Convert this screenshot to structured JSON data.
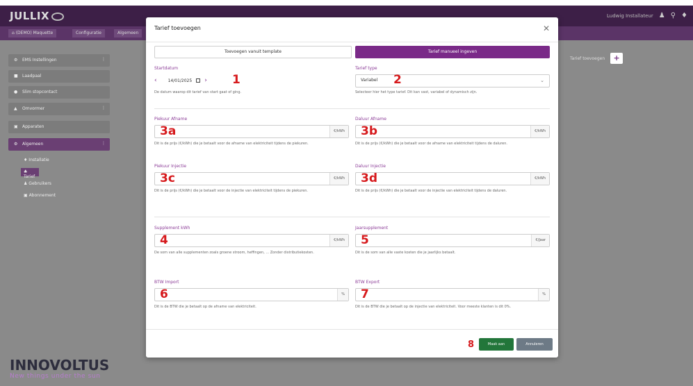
{
  "app": {
    "logo_text": "JULLIX"
  },
  "header": {
    "user_label": "Ludwig Installateur"
  },
  "breadcrumb": [
    {
      "label": "(DEMO) Maquette"
    },
    {
      "label": "Configuratie"
    },
    {
      "label": "Algemeen"
    }
  ],
  "sidebar": {
    "items": [
      {
        "icon": "gear-icon",
        "label": "EMS Instellingen",
        "has_menu": true
      },
      {
        "icon": "plug-icon",
        "label": "Laadpaal",
        "has_menu": false
      },
      {
        "icon": "socket-icon",
        "label": "Slim stopcontact",
        "has_menu": false
      },
      {
        "icon": "home-icon",
        "label": "Omvormer",
        "has_menu": true
      },
      {
        "icon": "device-icon",
        "label": "Apparaten",
        "has_menu": false
      },
      {
        "icon": "settings-icon",
        "label": "Algemeen",
        "has_menu": true,
        "active": true
      }
    ],
    "subitems": [
      {
        "label": "Installatie"
      },
      {
        "label": "Tarief",
        "active": true
      },
      {
        "label": "Gebruikers"
      },
      {
        "label": "Abonnement"
      }
    ],
    "brand": "INNOVOLTUS",
    "brand_tagline": "New things under the sun"
  },
  "background": {
    "add_tariff_label": "Tarief toevoegen",
    "add_icon": "plus-icon"
  },
  "modal": {
    "title": "Tarief toevoegen",
    "template_button": "Toevoegen vanuit template",
    "manual_button": "Tarief manueel ingeven",
    "start_date": {
      "label": "Startdatum",
      "value": "14/01/2025",
      "help": "De datum waarop dit tarief van start gaat of ging."
    },
    "tariff_type": {
      "label": "Tarief type",
      "value": "Variabel",
      "help": "Selecteer hier het type tarief. Dit kan vast, variabel of dynamisch zijn."
    },
    "peak_purchase": {
      "label": "Piekuur Afname",
      "unit": "€/kWh",
      "help": "Dit is de prijs (€/kWh) die je betaalt voor de afname van elektriciteit tijdens de piekuren."
    },
    "offpeak_purchase": {
      "label": "Daluur Afname",
      "unit": "€/kWh",
      "help": "Dit is de prijs (€/kWh) die je betaalt voor de afname van elektriciteit tijdens de daluren."
    },
    "peak_injection": {
      "label": "Piekuur Injectie",
      "unit": "€/kWh",
      "help": "Dit is de prijs (€/kWh) die je betaalt voor de injectie van elektriciteit tijdens de piekuren."
    },
    "offpeak_injection": {
      "label": "Daluur Injectie",
      "unit": "€/kWh",
      "help": "Dit is de prijs (€/kWh) die je betaalt voor de injectie van elektriciteit tijdens de daluren."
    },
    "supplement_kwh": {
      "label": "Supplement kWh",
      "unit": "€/kWh",
      "help": "De som van alle supplementen zoals groene stroom, heffingen, ... Zonder distributiekosten."
    },
    "year_supplement": {
      "label": "Jaarsupplement",
      "unit": "€/Jaar",
      "help": "Dit is de som van alle vaste kosten die je jaarlijks betaalt."
    },
    "vat_import": {
      "label": "BTW Import",
      "unit": "%",
      "help": "Dit is de BTW die je betaalt op de afname van elektriciteit."
    },
    "vat_export": {
      "label": "BTW Export",
      "unit": "%",
      "help": "Dit is de BTW die je betaalt op de injectie van elektriciteit. Voor meeste klanten is dit 0%."
    },
    "save_button": "Maak aan",
    "cancel_button": "Annuleren"
  },
  "annotations": {
    "m1": "1",
    "m2": "2",
    "m3a": "3a",
    "m3b": "3b",
    "m3c": "3c",
    "m3d": "3d",
    "m4": "4",
    "m5": "5",
    "m6": "6",
    "m7": "7",
    "m8": "8"
  },
  "colors": {
    "accent": "#7a2a88",
    "marker": "#d6191c",
    "save": "#22763a",
    "cancel": "#6d7a86"
  }
}
